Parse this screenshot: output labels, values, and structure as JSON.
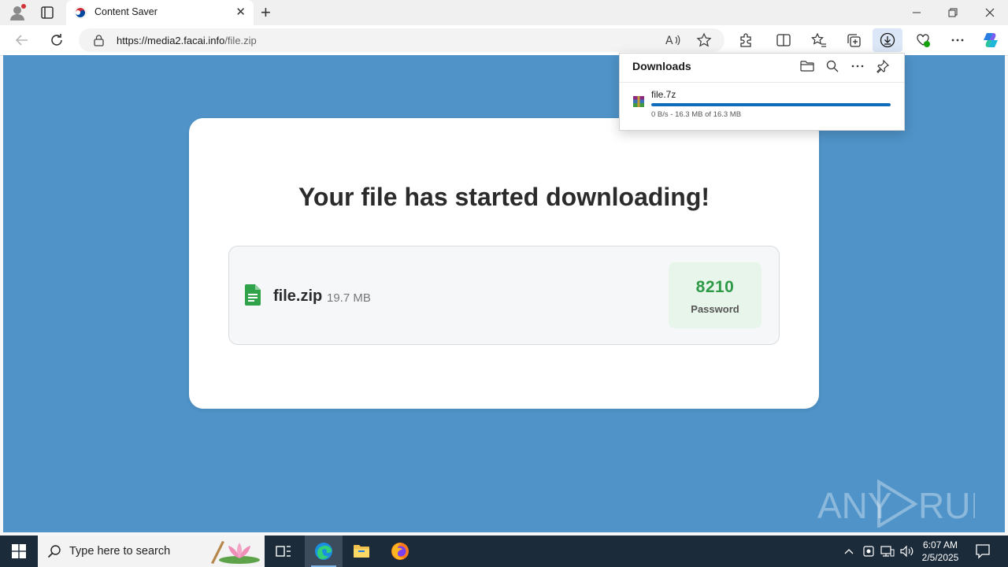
{
  "browser": {
    "tab": {
      "title": "Content Saver"
    },
    "url": {
      "host": "https://media2.facai.info",
      "path": "/file.zip"
    }
  },
  "page": {
    "headline": "Your file has started downloading!",
    "file": {
      "name": "file.zip",
      "size": "19.7 MB"
    },
    "password": {
      "value": "8210",
      "label": "Password"
    }
  },
  "downloads": {
    "title": "Downloads",
    "item": {
      "name": "file.7z",
      "status": "0 B/s - 16.3 MB of 16.3 MB",
      "progress": 1.0
    }
  },
  "taskbar": {
    "search_placeholder": "Type here to search",
    "time": "6:07 AM",
    "date": "2/5/2025"
  },
  "watermark": {
    "text": "ANY RUN"
  },
  "colors": {
    "page_bg": "#4f93c8",
    "password_green": "#2e9a48",
    "progress_blue": "#0f6cbd",
    "taskbar": "#1c2b3a"
  }
}
